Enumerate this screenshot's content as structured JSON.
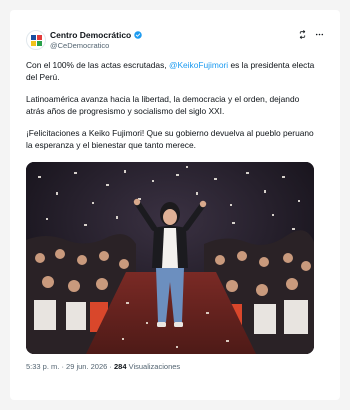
{
  "account": {
    "display_name": "Centro Democrático",
    "handle": "@CeDemocratico"
  },
  "tweet": {
    "line1_before": "Con el 100% de las actas escrutadas, ",
    "mention": "@KeikoFujimori",
    "line1_after": " es la presidenta electa del Perú.",
    "paragraph2": "Latinoamérica avanza hacia la libertad, la democracia y el orden, dejando atrás años de progresismo y socialismo del siglo XXI.",
    "paragraph3": "¡Felicitaciones a Keiko Fujimori! Que su gobierno devuelva al pueblo peruano la esperanza y el bienestar que tanto merece."
  },
  "meta": {
    "time": "5:33 p. m.",
    "separator": " · ",
    "date": "29 jun. 2026",
    "views_count": "284",
    "views_label": " Visualizaciones"
  },
  "icons": {
    "verified": "verified-badge-icon",
    "repost": "repost-icon",
    "more": "more-icon"
  },
  "colors": {
    "accent": "#1d9bf0",
    "text": "#0f1419",
    "muted": "#536471"
  }
}
